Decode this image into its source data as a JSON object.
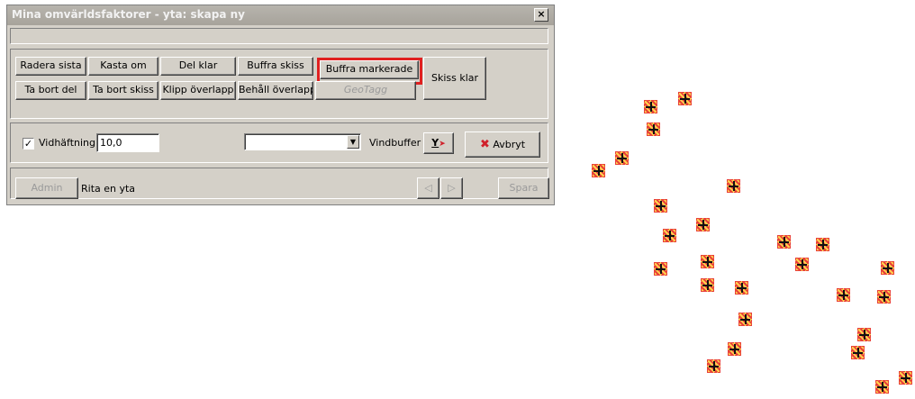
{
  "window": {
    "title": "Mina omvärldsfaktorer - yta: skapa ny",
    "close_glyph": "×"
  },
  "toolbar": {
    "row1": [
      "Radera sista",
      "Kasta om",
      "Del klar",
      "Buffra skiss",
      "Buffra markerade"
    ],
    "row2": [
      "Ta bort del",
      "Ta bort skiss",
      "Klipp överlapp",
      "Behåll överlapp",
      "GeoTagg"
    ],
    "done": "Skiss klar",
    "highlighted": "Buffra markerade"
  },
  "options": {
    "snap_checked": true,
    "snap_label": "Vidhäftning",
    "snap_value": "10,0",
    "dropdown_value": "",
    "windbuffer_label": "Vindbuffer",
    "windbuffer_icon": "Y",
    "cancel_label": "Avbryt",
    "cancel_icon": "✖"
  },
  "footer": {
    "admin": "Admin",
    "status": "Rita en yta",
    "prev_icon": "◁",
    "next_icon": "▷",
    "save": "Spara"
  },
  "map": {
    "marker_icon": "point-marker-icon",
    "marker_color": "#e8403a"
  }
}
